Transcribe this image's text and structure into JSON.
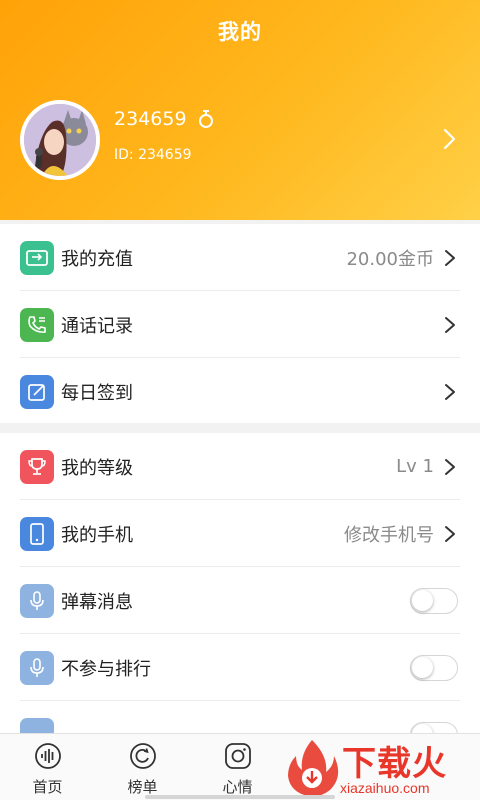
{
  "header": {
    "title": "我的",
    "username": "234659",
    "user_id": "ID: 234659"
  },
  "colors": {
    "header_gradient_start": "#ffa208",
    "header_gradient_end": "#ffd047",
    "icon_teal": "#3bc08f",
    "icon_green": "#4cb651",
    "icon_blue": "#4a88e0",
    "icon_red": "#f0545c",
    "icon_soft_blue": "#8fb3e0"
  },
  "group1": {
    "rows": [
      {
        "label": "我的充值",
        "value": "20.00金币",
        "icon": "wallet-icon"
      },
      {
        "label": "通话记录",
        "value": "",
        "icon": "call-log-icon"
      },
      {
        "label": "每日签到",
        "value": "",
        "icon": "edit-icon"
      }
    ]
  },
  "group2": {
    "rows": [
      {
        "label": "我的等级",
        "value": "Lv 1",
        "icon": "trophy-icon"
      },
      {
        "label": "我的手机",
        "value": "修改手机号",
        "icon": "phone-icon"
      },
      {
        "label": "弹幕消息",
        "toggle": false,
        "icon": "microphone-icon"
      },
      {
        "label": "不参与排行",
        "toggle": false,
        "icon": "microphone-icon"
      }
    ]
  },
  "tabbar": {
    "tabs": [
      {
        "label": "首页",
        "icon": "voice-wave-icon"
      },
      {
        "label": "榜单",
        "icon": "refresh-icon"
      },
      {
        "label": "心情",
        "icon": "camera-icon"
      }
    ]
  },
  "watermark": {
    "brand": "下载火",
    "site": "xiazaihuo.com"
  }
}
